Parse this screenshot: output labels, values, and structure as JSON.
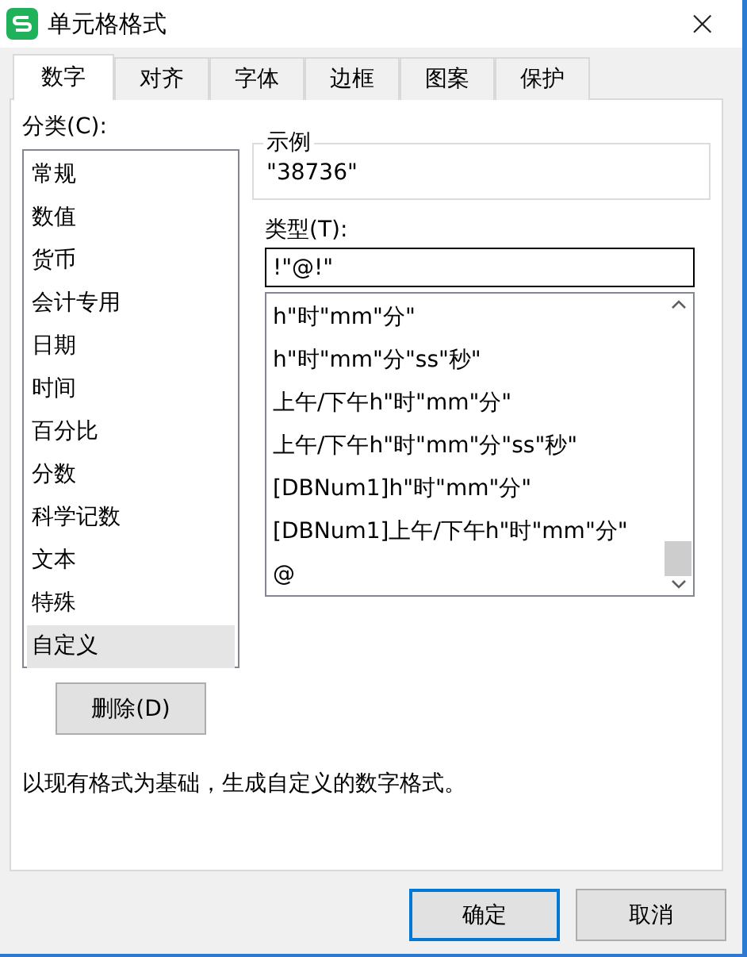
{
  "window": {
    "title": "单元格格式",
    "close": "×"
  },
  "tabs": [
    {
      "label": "数字",
      "selected": true
    },
    {
      "label": "对齐",
      "selected": false
    },
    {
      "label": "字体",
      "selected": false
    },
    {
      "label": "边框",
      "selected": false
    },
    {
      "label": "图案",
      "selected": false
    },
    {
      "label": "保护",
      "selected": false
    }
  ],
  "category": {
    "label": "分类(C):",
    "items": [
      {
        "label": "常规",
        "selected": false
      },
      {
        "label": "数值",
        "selected": false
      },
      {
        "label": "货币",
        "selected": false
      },
      {
        "label": "会计专用",
        "selected": false
      },
      {
        "label": "日期",
        "selected": false
      },
      {
        "label": "时间",
        "selected": false
      },
      {
        "label": "百分比",
        "selected": false
      },
      {
        "label": "分数",
        "selected": false
      },
      {
        "label": "科学记数",
        "selected": false
      },
      {
        "label": "文本",
        "selected": false
      },
      {
        "label": "特殊",
        "selected": false
      },
      {
        "label": "自定义",
        "selected": true
      }
    ]
  },
  "delete_button": "删除(D)",
  "sample": {
    "legend": "示例",
    "value": "\"38736\""
  },
  "type": {
    "label": "类型(T):",
    "value": "!\"@!\"",
    "items": [
      {
        "label": "h\"时\"mm\"分\""
      },
      {
        "label": "h\"时\"mm\"分\"ss\"秒\""
      },
      {
        "label": "上午/下午h\"时\"mm\"分\""
      },
      {
        "label": "上午/下午h\"时\"mm\"分\"ss\"秒\""
      },
      {
        "label": "[DBNum1]h\"时\"mm\"分\""
      },
      {
        "label": "[DBNum1]上午/下午h\"时\"mm\"分\""
      },
      {
        "label": "@"
      }
    ]
  },
  "description": "以现有格式为基础，生成自定义的数字格式。",
  "buttons": [
    {
      "label": "确定",
      "kind": "default"
    },
    {
      "label": "取消",
      "kind": "normal"
    }
  ]
}
